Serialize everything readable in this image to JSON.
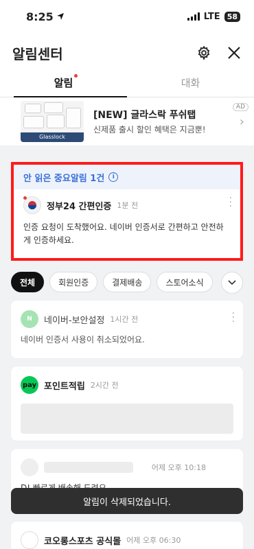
{
  "status": {
    "time": "8:25",
    "network": "LTE",
    "battery": "58"
  },
  "header": {
    "title": "알림센터"
  },
  "tabs": [
    {
      "label": "알림"
    },
    {
      "label": "대화"
    }
  ],
  "ad": {
    "title": "[NEW] 글라스락 푸쉬탭",
    "subtitle": "신제품 출시 할인 혜택은 지금뿐!",
    "badge": "AD",
    "brand": "Glasslock"
  },
  "important": {
    "header": "안 읽은 중요알림 1건",
    "sender": "정부24 간편인증",
    "time": "1분 전",
    "message": "인증 요청이 도착했어요. 네이버 인증서로 간편하고 안전하게 인증하세요."
  },
  "filters": [
    "전체",
    "회원인증",
    "결제배송",
    "스토어소식"
  ],
  "notifications": [
    {
      "sender": "네이버-보안설정",
      "time": "1시간 전",
      "message": "네이버 인증서 사용이 취소되었어요.",
      "avatar": "N",
      "avatar_color": "#a6e3b3"
    },
    {
      "sender": "포인트적립",
      "time": "2시간 전",
      "avatar": "pay",
      "avatar_color": "#06c755"
    },
    {
      "sender": "",
      "time": "어제 오후 10:18",
      "message": "D! 빠르게 배송해 드려요."
    },
    {
      "sender": "코오롱스포츠 공식몰",
      "time": "어제 오후 06:30"
    }
  ],
  "toast": "알림이 삭제되었습니다.",
  "colors": {
    "accent_blue": "#3a6fd8",
    "highlight_red": "#ff1a1a",
    "dot_red": "#e8432e"
  }
}
